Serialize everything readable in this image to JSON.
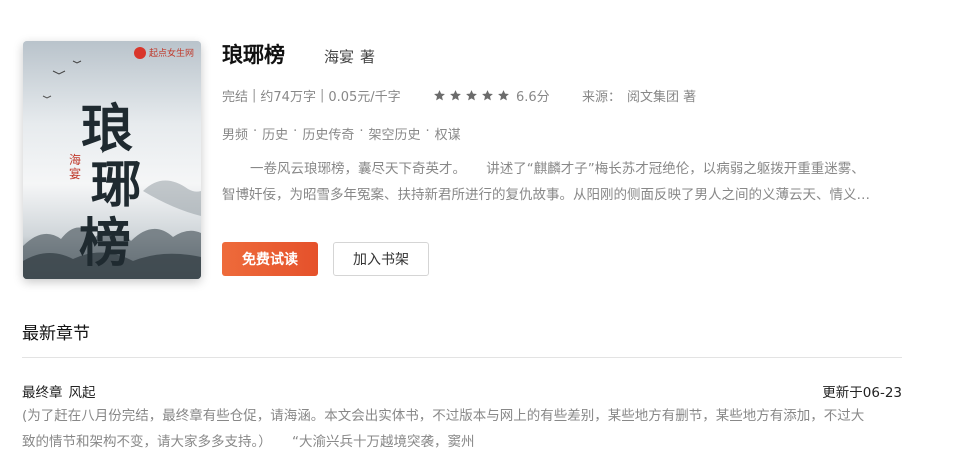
{
  "book": {
    "title": "琅琊榜",
    "author": "海宴",
    "author_suffix": "著",
    "cover": {
      "publisher_logo": "起点女生网",
      "title_calligraphy": [
        "琅",
        "琊",
        "榜"
      ],
      "author_seal": "海宴"
    }
  },
  "meta": {
    "status": "完结",
    "word_count": "约74万字",
    "price": "0.05元/千字",
    "separator": "|",
    "rating_stars": 5,
    "score": "6.6分",
    "source_label": "来源：",
    "source_value": "阅文集团 著"
  },
  "tags": [
    "男频",
    "历史",
    "历史传奇",
    "架空历史",
    "权谋"
  ],
  "tag_separator": "·",
  "description": {
    "line1": "一卷风云琅琊榜，囊尽天下奇英才。　　讲述了“麒麟才子”梅长苏才冠绝伦，以病弱之躯拨开重重迷雾、",
    "line2": "智博奸佞，为昭雪多年冤案、扶持新君所进行的复仇故事。从阳刚的侧面反映了男人之间的义薄云天、情义…"
  },
  "buttons": {
    "trial": "免费试读",
    "shelf": "加入书架"
  },
  "latest": {
    "section_title": "最新章节",
    "chapter_label": "最终章",
    "chapter_name": "风起",
    "update_time": "更新于06-23",
    "excerpt_line1": "(为了赶在八月份完结，最终章有些仓促，请海涵。本文会出实体书，不过版本与网上的有些差别，某些地方有删节，某些地方有添加，不过大",
    "excerpt_line2": "致的情节和架构不变，请大家多多支持。）　　“大渝兴兵十万越境突袭，窦州"
  },
  "colors": {
    "accent": "#e8582f",
    "muted_text": "#888888",
    "star": "#6b6b6b"
  }
}
